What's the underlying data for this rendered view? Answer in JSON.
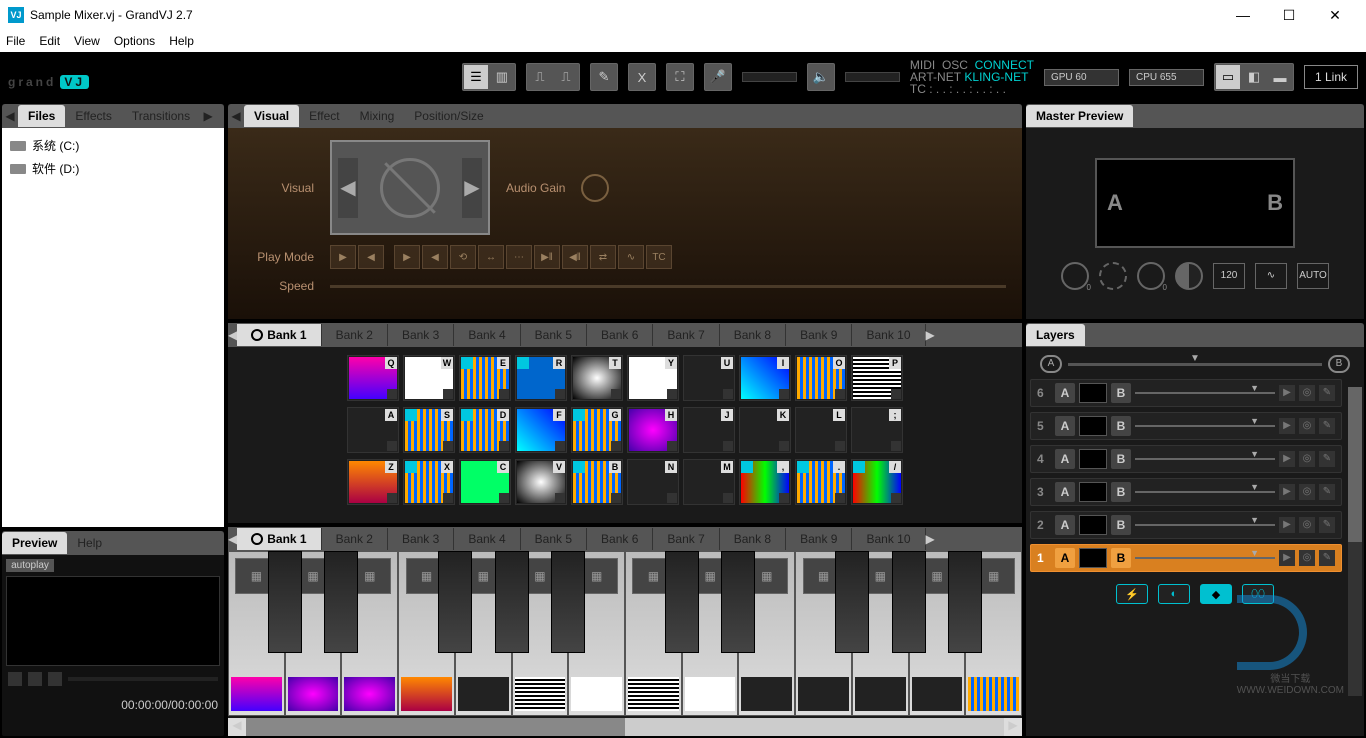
{
  "window": {
    "title": "Sample Mixer.vj - GrandVJ 2.7",
    "logo_icon": "VJ"
  },
  "menubar": [
    "File",
    "Edit",
    "View",
    "Options",
    "Help"
  ],
  "topbar": {
    "logo_left": "grand",
    "logo_right": "VJ",
    "status": {
      "midi": "MIDI",
      "osc": "OSC",
      "connect": "CONNECT",
      "artnet": "ART-NET",
      "klingnet": "KLING-NET",
      "tc": "TC : . . : . . : . . : . ."
    },
    "gpu": "GPU 60",
    "cpu": "CPU 655",
    "link": "1 Link"
  },
  "left": {
    "tabs": [
      "Files",
      "Effects",
      "Transitions"
    ],
    "drives": [
      "系统 (C:)",
      "软件 (D:)"
    ],
    "preview_tabs": [
      "Preview",
      "Help"
    ],
    "autoplay": "autoplay",
    "time": "00:00:00/00:00:00"
  },
  "visual": {
    "tabs": [
      "Visual",
      "Effect",
      "Mixing",
      "Position/Size"
    ],
    "label_visual": "Visual",
    "label_gain": "Audio Gain",
    "label_playmode": "Play Mode",
    "label_speed": "Speed",
    "tc_btn": "TC"
  },
  "banks": {
    "tabs": [
      "Bank 1",
      "Bank 2",
      "Bank 3",
      "Bank 4",
      "Bank 5",
      "Bank 6",
      "Bank 7",
      "Bank 8",
      "Bank 9",
      "Bank 10"
    ],
    "row1_keys": [
      "Q",
      "W",
      "E",
      "R",
      "T",
      "Y",
      "U",
      "I",
      "O",
      "P"
    ],
    "row2_keys": [
      "A",
      "S",
      "D",
      "F",
      "G",
      "H",
      "J",
      "K",
      "L",
      ";"
    ],
    "row3_keys": [
      "Z",
      "X",
      "C",
      "V",
      "B",
      "N",
      "M",
      ",",
      ".",
      "/"
    ]
  },
  "master": {
    "title": "Master Preview",
    "a": "A",
    "b": "B",
    "bpm": "120",
    "auto": "AUTO",
    "zero": "0"
  },
  "layers": {
    "title": "Layers",
    "a": "A",
    "b": "B",
    "rows": [
      6,
      5,
      4,
      3,
      2,
      1
    ]
  },
  "watermark": {
    "line1": "微当下载",
    "line2": "WWW.WEIDOWN.COM"
  }
}
